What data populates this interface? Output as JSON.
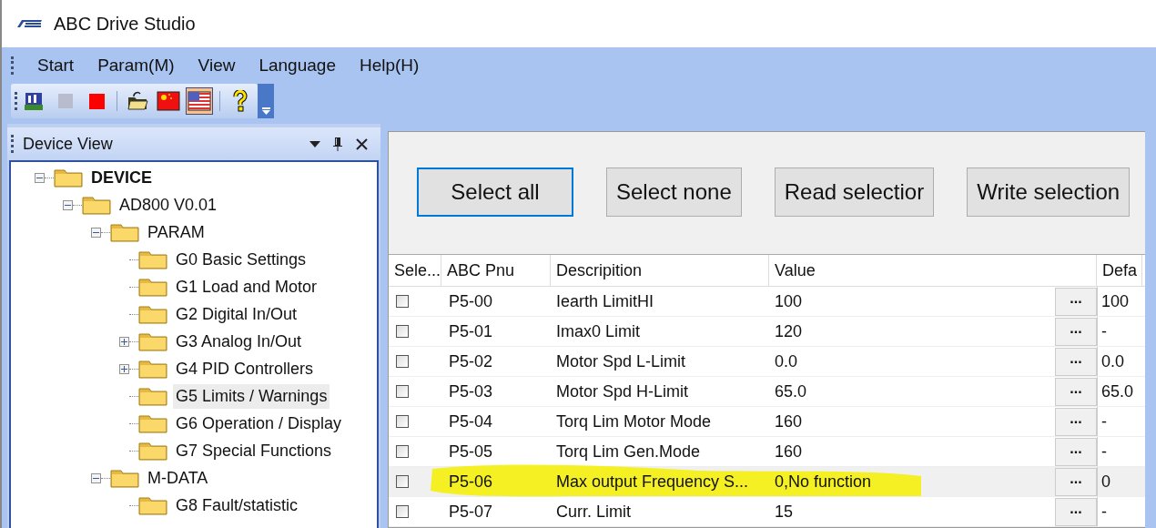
{
  "window": {
    "title": "ABC Drive Studio"
  },
  "menu": [
    "Start",
    "Param(M)",
    "View",
    "Language",
    "Help(H)"
  ],
  "toolbar": [
    {
      "kind": "device"
    },
    {
      "kind": "gray-square"
    },
    {
      "kind": "red-square"
    },
    {
      "kind": "separator"
    },
    {
      "kind": "open"
    },
    {
      "kind": "flag-red",
      "selected": false
    },
    {
      "kind": "flag-striped",
      "selected": true
    },
    {
      "kind": "separator"
    },
    {
      "kind": "help"
    }
  ],
  "device_view": {
    "title": "Device View",
    "tree": [
      {
        "label": "DEVICE",
        "bold": true,
        "expanded": true,
        "selected": false,
        "children": [
          {
            "label": "AD800 V0.01",
            "expanded": true,
            "selected": false,
            "children": [
              {
                "label": "PARAM",
                "expanded": true,
                "selected": false,
                "children": [
                  {
                    "label": "G0 Basic Settings",
                    "selected": false
                  },
                  {
                    "label": "G1 Load and Motor",
                    "selected": false
                  },
                  {
                    "label": "G2 Digital In/Out",
                    "selected": false
                  },
                  {
                    "label": "G3 Analog In/Out",
                    "expanded": false,
                    "selected": false
                  },
                  {
                    "label": "G4 PID Controllers",
                    "expanded": false,
                    "selected": false
                  },
                  {
                    "label": "G5 Limits / Warnings",
                    "selected": true
                  },
                  {
                    "label": "G6 Operation / Display",
                    "selected": false
                  },
                  {
                    "label": "G7 Special Functions",
                    "selected": false
                  }
                ]
              },
              {
                "label": "M-DATA",
                "expanded": true,
                "selected": false,
                "children": [
                  {
                    "label": "G8 Fault/statistic",
                    "selected": false
                  }
                ]
              }
            ]
          }
        ]
      }
    ]
  },
  "actions": [
    {
      "label": "Select all",
      "focused": true
    },
    {
      "label": "Select none",
      "focused": false
    },
    {
      "label": "Read selectior",
      "focused": false
    },
    {
      "label": "Write selection",
      "focused": false
    }
  ],
  "table": {
    "columns": [
      "Sele...",
      "ABC Pnu",
      "Descripition",
      "Value",
      "Defa"
    ],
    "rows": [
      {
        "checked": false,
        "pnu": "P5-00",
        "description": "Iearth LimitHI",
        "value": "100",
        "button": "...",
        "default": "100",
        "highlighted": false
      },
      {
        "checked": false,
        "pnu": "P5-01",
        "description": "Imax0 Limit",
        "value": "120",
        "button": "...",
        "default": "-",
        "highlighted": false
      },
      {
        "checked": false,
        "pnu": "P5-02",
        "description": "Motor Spd L-Limit",
        "value": "0.0",
        "button": "...",
        "default": "0.0",
        "highlighted": false
      },
      {
        "checked": false,
        "pnu": "P5-03",
        "description": "Motor Spd H-Limit",
        "value": "65.0",
        "button": "...",
        "default": "65.0",
        "highlighted": false
      },
      {
        "checked": false,
        "pnu": "P5-04",
        "description": "Torq Lim Motor Mode",
        "value": "160",
        "button": "...",
        "default": "-",
        "highlighted": false
      },
      {
        "checked": false,
        "pnu": "P5-05",
        "description": "Torq Lim Gen.Mode",
        "value": "160",
        "button": "...",
        "default": "-",
        "highlighted": false
      },
      {
        "checked": false,
        "pnu": "P5-06",
        "description": "Max output Frequency S...",
        "value": "0,No function",
        "button": "...",
        "default": "0",
        "highlighted": true
      },
      {
        "checked": false,
        "pnu": "P5-07",
        "description": "Curr. Limit",
        "value": "15",
        "button": "...",
        "default": "-",
        "highlighted": false
      }
    ]
  }
}
